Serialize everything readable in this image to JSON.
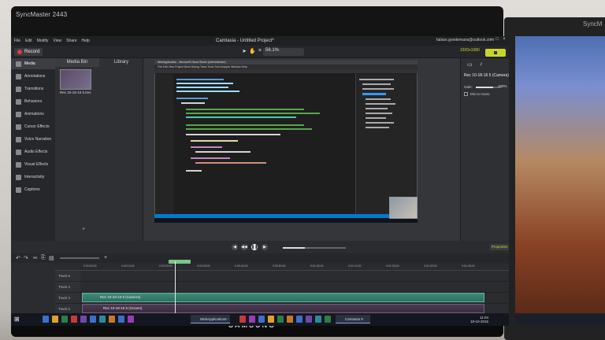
{
  "monitor": {
    "brand_label": "SyncMaster 2443",
    "bezel_logo": "SAMSUNG",
    "second_brand": "SyncM"
  },
  "app": {
    "title": "Camtasia - Untitled Project*",
    "user_email": "fabian.goedemans@outlook.com",
    "menu": [
      "File",
      "Edit",
      "Modify",
      "View",
      "Share",
      "Help"
    ],
    "record_label": "Record",
    "zoom": "56.1%",
    "resolution_badge": "1920x1080"
  },
  "tools": [
    {
      "label": "Media",
      "active": true
    },
    {
      "label": "Annotations"
    },
    {
      "label": "Transitions"
    },
    {
      "label": "Behaviors"
    },
    {
      "label": "Animations"
    },
    {
      "label": "Cursor Effects"
    },
    {
      "label": "Voice Narration"
    },
    {
      "label": "Audio Effects"
    },
    {
      "label": "Visual Effects"
    },
    {
      "label": "Interactivity"
    },
    {
      "label": "Captions"
    }
  ],
  "bin": {
    "tab_media_bin": "Media Bin",
    "tab_library": "Library",
    "thumb_label": "Rec 10-18-16 5.trec"
  },
  "canvas": {
    "vs_title": "WebApplication - Microsoft Visual Studio (Administrator)",
    "vs_menu": "File  Edit  View  Project  Build  Debug  Team  Tools  Test  Analyze  Window  Help"
  },
  "properties": {
    "title": "Rec 10-18-16 5 (Camera)",
    "gain_label": "Gain:",
    "gain_value": "100%",
    "gain_level": 0.7,
    "mix_label": "Mix to mono"
  },
  "playback": {
    "properties_button": "Properties",
    "progress": 0.35
  },
  "timeline": {
    "ticks": [
      "0:00:00;00",
      "0:00:10;00",
      "0:00:20;00",
      "0:00:30;00",
      "0:00:40;00",
      "0:00:50;00",
      "0:01:00;00",
      "0:01:10;00",
      "0:01:20;00",
      "0:01:30;00",
      "0:01:40;00"
    ],
    "tracks": [
      "Track 5",
      "Track 4",
      "Track 3",
      "Track 2",
      "Track 1"
    ],
    "clip_camera": "Rec 10-18-16 5 (Camera)",
    "clip_screen": "Rec 10-18-16 5 (Screen)"
  },
  "taskbar": {
    "app1": "WebApplication6 - ...",
    "app2": "Camtasia 9",
    "time": "11:04",
    "date": "18-10-2016"
  }
}
